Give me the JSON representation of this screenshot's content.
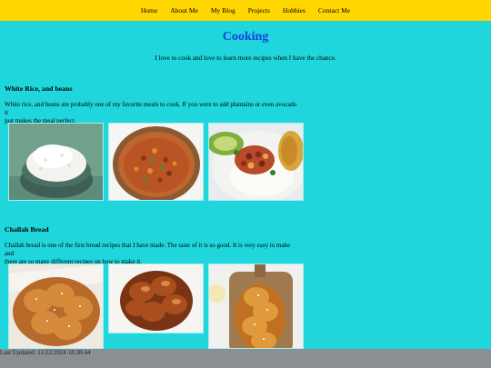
{
  "nav": {
    "items": [
      "Home",
      "About Me",
      "My Blog",
      "Projects",
      "Hobbies",
      "Contact Me"
    ]
  },
  "page": {
    "title": "Cooking",
    "intro": "I love to cook and love to learn more recipes when I have the chance."
  },
  "sections": [
    {
      "title": "White Rice, and beans",
      "text_line1": "White rice, and beans are probably one of my favorite meals to cook. If you were to add plantains or even avocado it",
      "text_line2": "just makes the meal perfect."
    },
    {
      "title": "Challah Bread",
      "text_line1": "Challah bread is one of the first bread recipes that I have made. The taste of it is so good. It is very easy to make and",
      "text_line2": "there are so many different recipes on how to make it."
    }
  ],
  "footer": {
    "last_updated": "Last Updated: 11/22/2024 18:38:44"
  },
  "colors": {
    "background": "#1fd6dd",
    "navbar": "#ffd600",
    "title": "#1a3fe0",
    "footer": "#8c8f92"
  }
}
